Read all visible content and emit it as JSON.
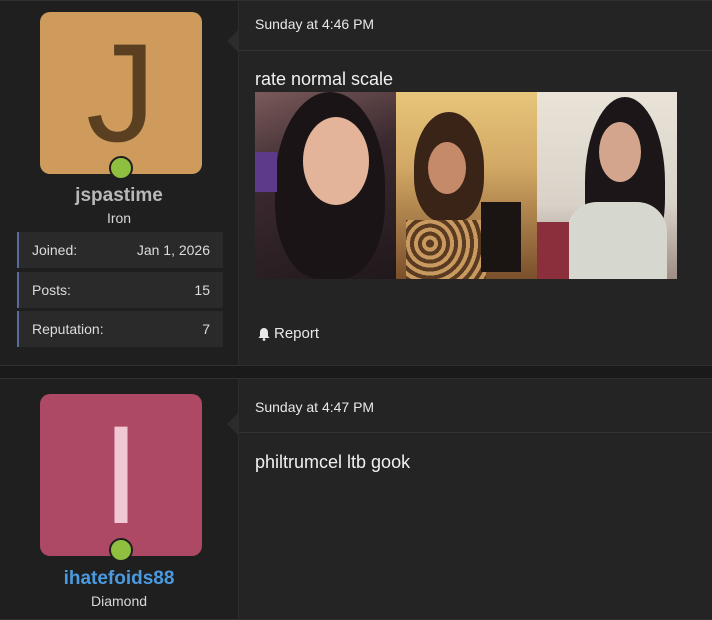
{
  "posts": [
    {
      "avatar_letter": "J",
      "avatar_bg": "#cf9b5d",
      "avatar_fg": "#5a4020",
      "username": "jspastime",
      "username_color": "#b8b8b8",
      "rank": "Iron",
      "stats": [
        {
          "label": "Joined:",
          "value": "Jan 1, 2026"
        },
        {
          "label": "Posts:",
          "value": "15"
        },
        {
          "label": "Reputation:",
          "value": "7"
        }
      ],
      "date": "Sunday at 4:46 PM",
      "message": "rate normal scale",
      "report_label": "Report"
    },
    {
      "avatar_letter": "I",
      "avatar_bg": "#ad4865",
      "avatar_fg": "#f0c7d2",
      "username": "ihatefoids88",
      "username_color": "#4a9ae0",
      "rank": "Diamond",
      "date": "Sunday at 4:47 PM",
      "message": "philtrumcel ltb gook"
    }
  ],
  "icons": {
    "online": "online-indicator",
    "report": "bell-icon"
  }
}
